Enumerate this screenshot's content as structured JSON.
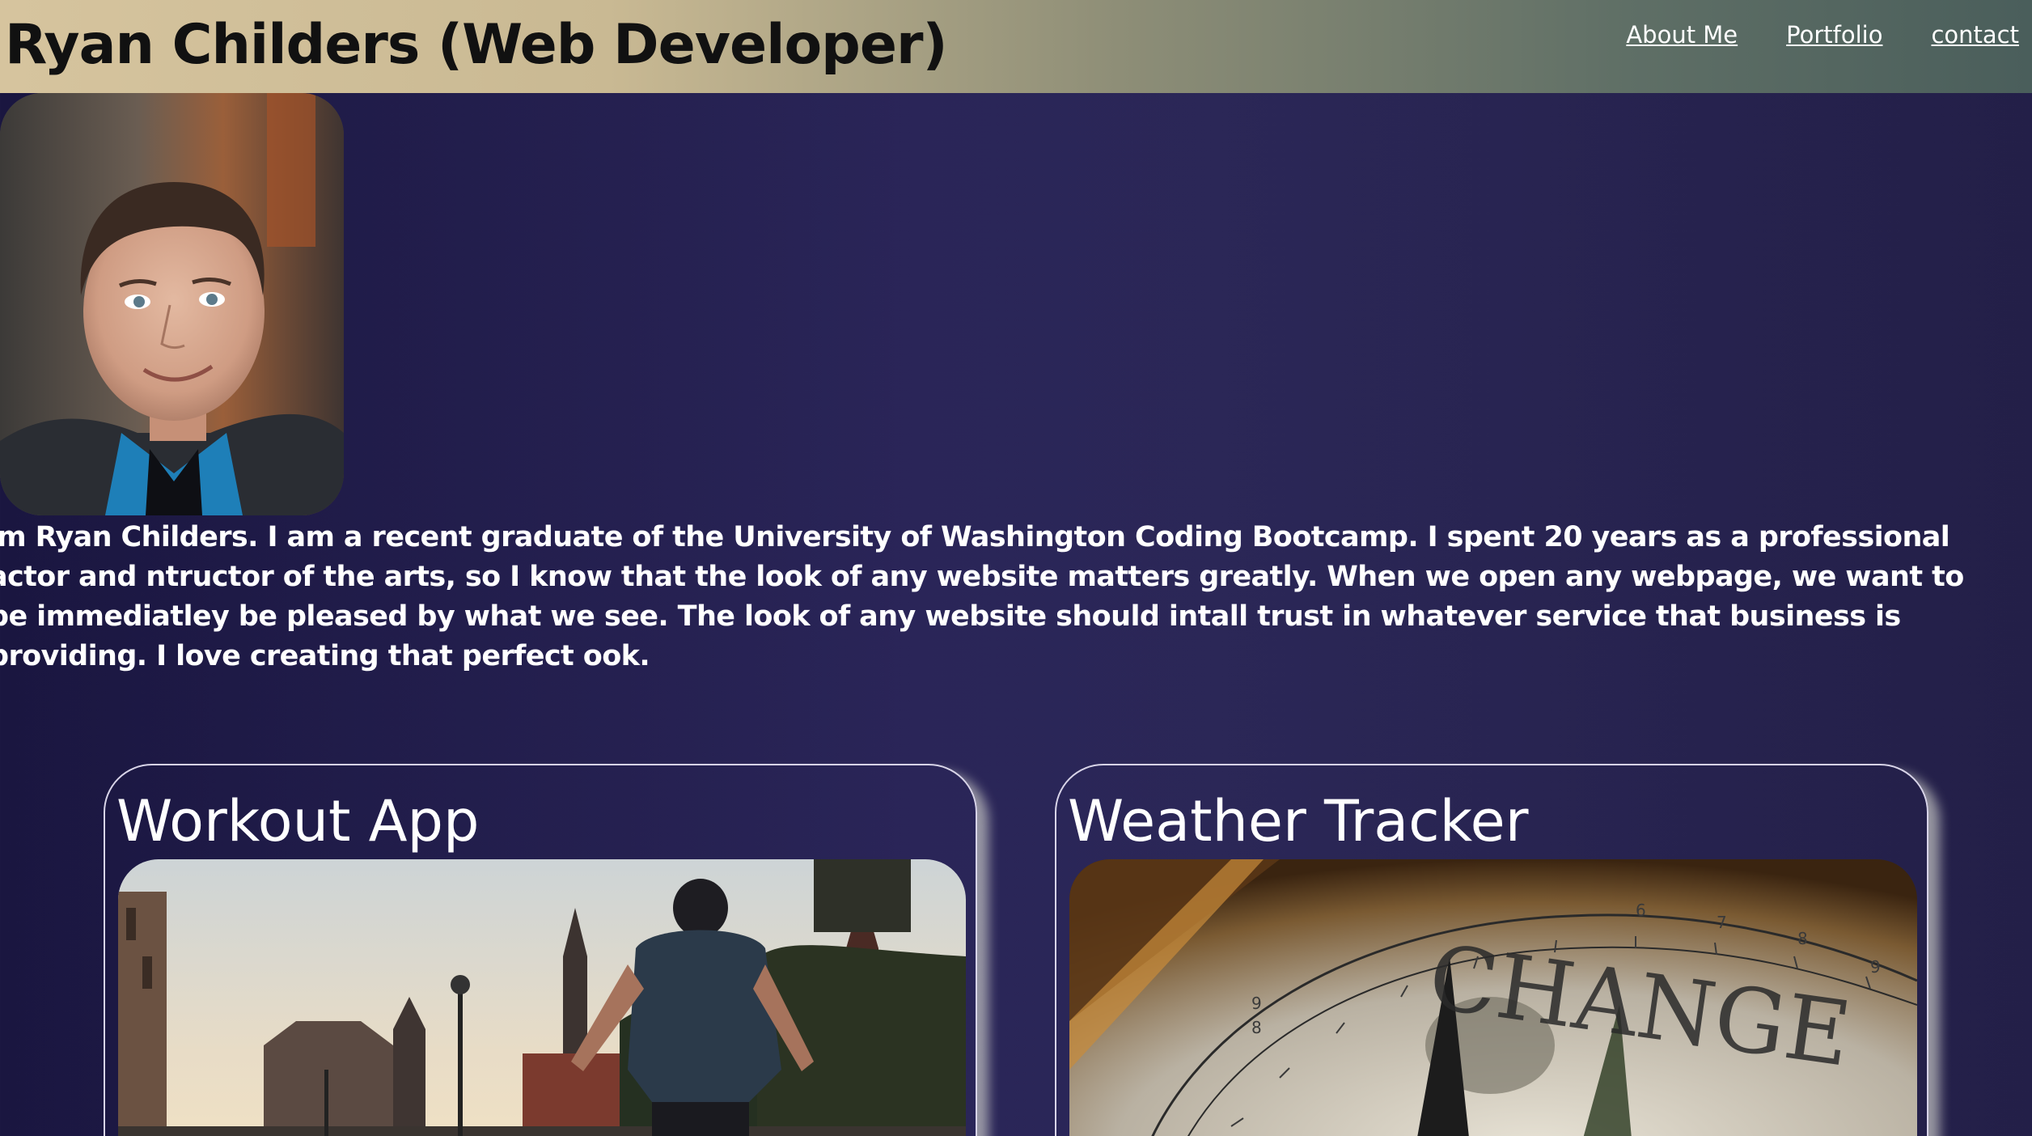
{
  "header": {
    "title": "Ryan Childers (Web Developer)",
    "nav": [
      "About Me",
      "Portfolio",
      "contact"
    ]
  },
  "about": {
    "bio": "'m Ryan Childers. I am a recent graduate of the University of Washington Coding Bootcamp. I spent 20 years as a professional actor and ntructor of the arts, so I know that the look of any website matters greatly. When we open any webpage, we want to be immediatley be pleased by what we see. The look of any website should intall trust in whatever service that business is providing. I love creating that perfect ook."
  },
  "portfolio": {
    "cards": [
      {
        "title": "Workout App"
      },
      {
        "title": "Weather Tracker"
      }
    ],
    "weather_image_text": "CHANGE"
  },
  "colors": {
    "background": "#2a2558",
    "header_left": "#d6c49e",
    "header_right": "#4a5e5b",
    "text": "#ffffff"
  }
}
